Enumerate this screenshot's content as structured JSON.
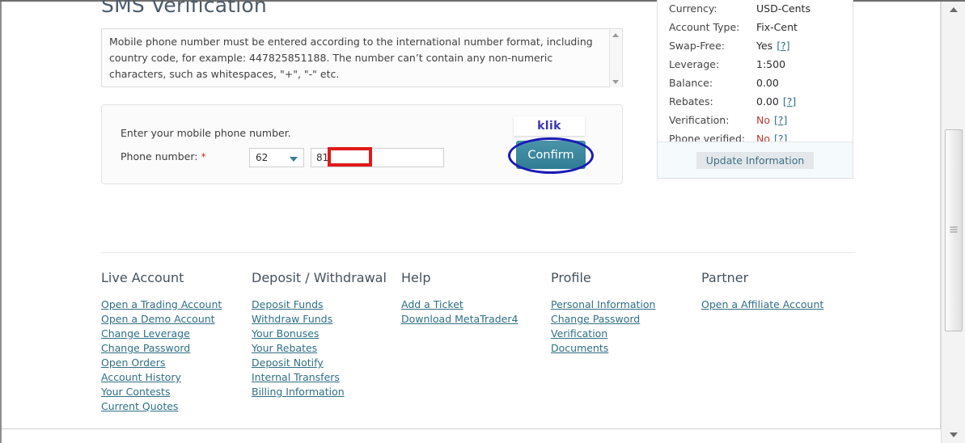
{
  "page": {
    "title": "SMS Verification",
    "notice": "Mobile phone number must be entered according to the international number format, including country code, for example: 447825851188. The number can’t contain any non-numeric characters, such as whitespaces, \"+\", \"-\" etc."
  },
  "form": {
    "hint": "Enter your mobile phone number.",
    "label": "Phone number:",
    "required_marker": "*",
    "country_code_value": "62",
    "phone_value": "81",
    "phone_placeholder": "",
    "confirm_label": "Confirm"
  },
  "annotations": {
    "klik_label": "klik",
    "highlight_color": "#e01b1b",
    "circle_color": "#1a1ab5",
    "klik_text_color": "#3b35b5"
  },
  "account": {
    "rows": [
      {
        "key": "Currency:",
        "value": "USD-Cents",
        "help": "",
        "negative": false
      },
      {
        "key": "Account Type:",
        "value": "Fix-Cent",
        "help": "",
        "negative": false
      },
      {
        "key": "Swap-Free:",
        "value": "Yes",
        "help": "[?]",
        "negative": false
      },
      {
        "key": "Leverage:",
        "value": "1:500",
        "help": "",
        "negative": false
      },
      {
        "key": "Balance:",
        "value": "0.00",
        "help": "",
        "negative": false
      },
      {
        "key": "Rebates:",
        "value": "0.00",
        "help": "[?]",
        "negative": false
      },
      {
        "key": "Verification:",
        "value": "No",
        "help": "[?]",
        "negative": true
      },
      {
        "key": "Phone verified:",
        "value": "No",
        "help": "[?]",
        "negative": true
      }
    ],
    "update_button": "Update Information"
  },
  "footer": {
    "columns": [
      {
        "heading": "Live Account",
        "links": [
          "Open a Trading Account",
          "Open a Demo Account",
          "Change Leverage",
          "Change Password",
          "Open Orders",
          "Account History",
          "Your Contests",
          "Current Quotes"
        ]
      },
      {
        "heading": "Deposit / Withdrawal",
        "links": [
          "Deposit Funds",
          "Withdraw Funds",
          "Your Bonuses",
          "Your Rebates",
          "Deposit Notify",
          "Internal Transfers",
          "Billing Information"
        ]
      },
      {
        "heading": "Help",
        "links": [
          "Add a Ticket",
          "Download MetaTrader4"
        ]
      },
      {
        "heading": "Profile",
        "links": [
          "Personal Information",
          "Change Password",
          "Verification",
          "Documents"
        ]
      },
      {
        "heading": "Partner",
        "links": [
          "Open a Affiliate Account"
        ]
      }
    ]
  },
  "scrollbar": {
    "up_icon": "triangle-up-icon",
    "down_icon": "triangle-down-icon"
  }
}
